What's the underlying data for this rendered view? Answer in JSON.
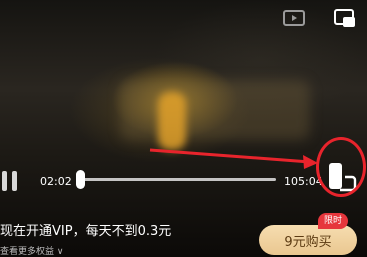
{
  "player": {
    "current_time": "02:02",
    "duration": "105:04",
    "progress": 0.01
  },
  "icons": {
    "tv_cast": "tv-cast-icon",
    "pip": "picture-in-picture-icon",
    "play_pause": "pause-icon",
    "rotate": "rotate-screen-icon"
  },
  "promo": {
    "text": "现在开通VIP，每天不到0.3元",
    "subtext": "查看更多权益 ∨",
    "buy_label": "9元购买",
    "limited_badge": "限时"
  },
  "colors": {
    "annotation": "#e8242c",
    "buy_button": "#eac790",
    "limited_badge": "#e6363c"
  }
}
